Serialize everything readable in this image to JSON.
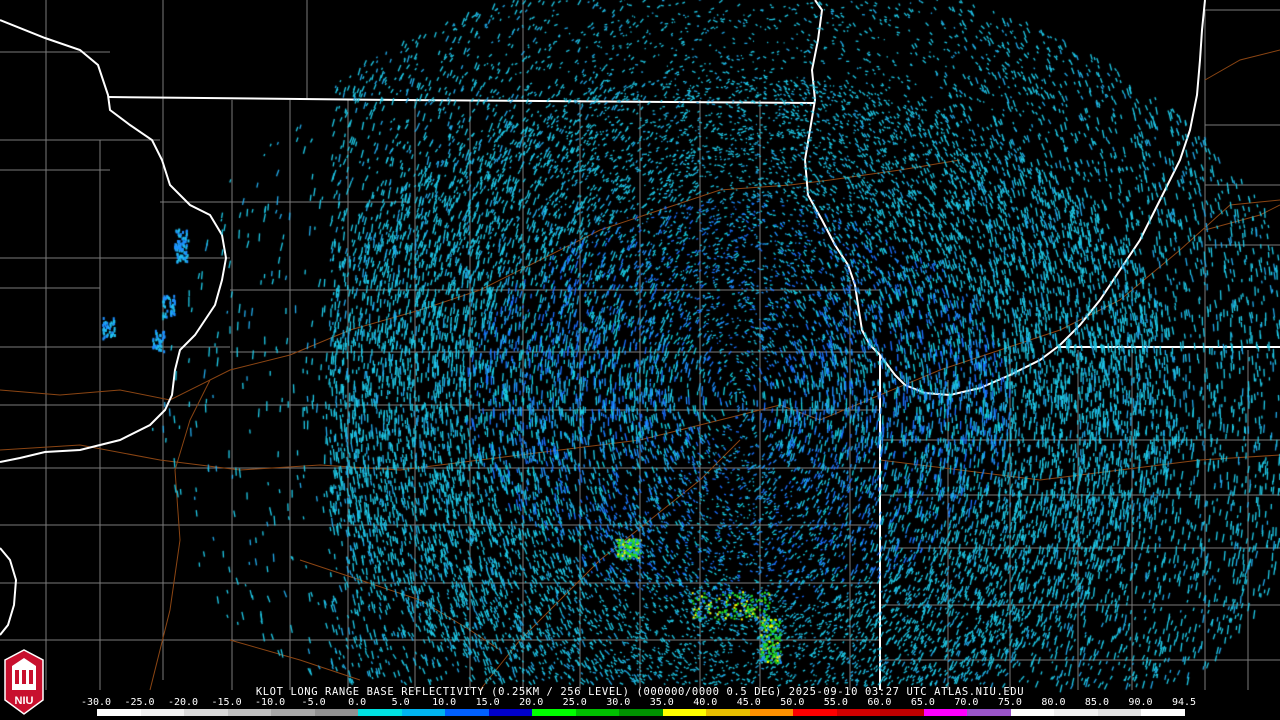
{
  "product_title": "KLOT LONG RANGE BASE REFLECTIVITY (0.25KM / 256 LEVEL) (000000/0000 0.5 DEG) 2025-09-10 03:27 UTC  ATLAS.NIU.EDU",
  "logo": {
    "text": "NIU",
    "colors": {
      "primary": "#c8102e",
      "secondary": "#ffffff"
    }
  },
  "colorbar": {
    "labels": [
      "-30.0",
      "-25.0",
      "-20.0",
      "-15.0",
      "-10.0",
      "-5.0",
      "0.0",
      "5.0",
      "10.0",
      "15.0",
      "20.0",
      "25.0",
      "30.0",
      "35.0",
      "40.0",
      "45.0",
      "50.0",
      "55.0",
      "60.0",
      "65.0",
      "70.0",
      "75.0",
      "80.0",
      "85.0",
      "90.0",
      "94.5"
    ],
    "colors": [
      "#ffffff",
      "#f0f0f0",
      "#d8d8d8",
      "#c0c0c0",
      "#a8a8a8",
      "#909090",
      "#00e0e0",
      "#00b4f0",
      "#0060ff",
      "#0000c8",
      "#00ff00",
      "#00c000",
      "#009000",
      "#ffff00",
      "#e8c000",
      "#ff9000",
      "#ff0000",
      "#d00000",
      "#c00000",
      "#ff00ff",
      "#9955c9",
      "#ffffff",
      "#f0f0f0",
      "#e0e0e0",
      "#ffffff"
    ]
  },
  "map_colors": {
    "background": "#000000",
    "state_borders": "#ffffff",
    "county_lines": "#7a7a7a",
    "highways": "#8b4513",
    "echo_primary": "#1ec8e6",
    "echo_secondary": "#1e90ff",
    "echo_moderate": "#22dd22",
    "echo_strong": "#ffff00"
  },
  "radar": {
    "site": "KLOT",
    "tilt_deg": 0.5
  }
}
